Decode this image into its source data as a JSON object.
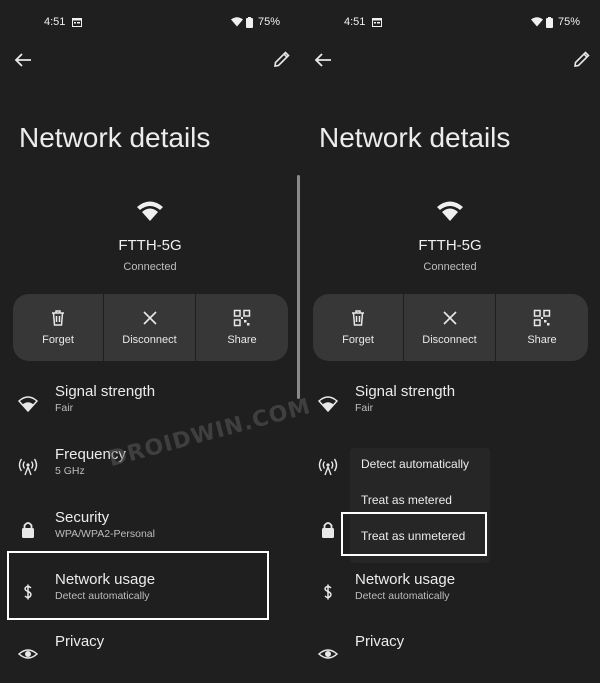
{
  "status": {
    "time": "4:51",
    "battery": "75%"
  },
  "title": "Network details",
  "network": {
    "ssid": "FTTH-5G",
    "status": "Connected"
  },
  "actions": {
    "forget": "Forget",
    "disconnect": "Disconnect",
    "share": "Share"
  },
  "rows": {
    "signal": {
      "title": "Signal strength",
      "sub": "Fair"
    },
    "frequency": {
      "title": "Frequency",
      "sub": "5 GHz"
    },
    "security": {
      "title": "Security",
      "sub": "WPA/WPA2-Personal"
    },
    "usage": {
      "title": "Network usage",
      "sub": "Detect automatically"
    },
    "privacy": {
      "title": "Privacy"
    }
  },
  "menu": {
    "options": [
      "Detect automatically",
      "Treat as metered",
      "Treat as unmetered"
    ]
  },
  "watermark": "DROIDWIN.COM",
  "colors": {
    "background": "#1f1f1f",
    "button_group": "#373737",
    "highlight": "#ffffff"
  },
  "icons": [
    "back-arrow-icon",
    "edit-pencil-icon",
    "wifi-icon",
    "trash-icon",
    "close-icon",
    "qr-code-icon",
    "antenna-icon",
    "lock-icon",
    "dollar-icon",
    "eye-icon"
  ]
}
